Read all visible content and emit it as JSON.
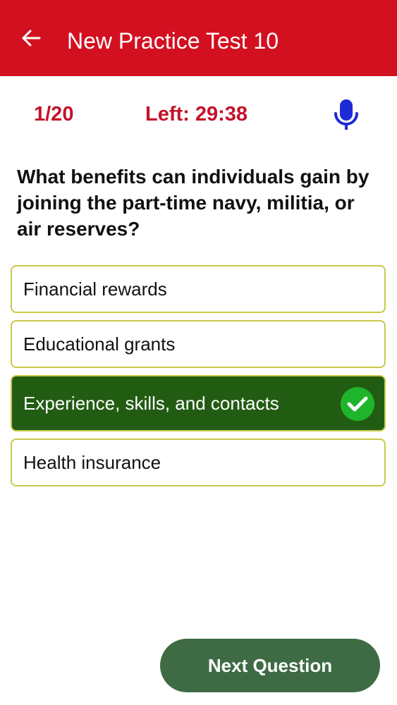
{
  "appbar": {
    "title": "New Practice Test 10",
    "back_icon": "arrow-left-icon",
    "background": "#d31020"
  },
  "status": {
    "counter": "1/20",
    "timer": "Left: 29:38",
    "mic_icon": "microphone-icon",
    "accent": "#c4132a",
    "mic_color": "#1d2bd6"
  },
  "question": {
    "text": "What benefits can individuals gain by joining the part-time navy, militia, or air reserves?"
  },
  "options": [
    {
      "label": "Financial rewards",
      "selected": false
    },
    {
      "label": "Educational grants",
      "selected": false
    },
    {
      "label": "Experience, skills, and contacts",
      "selected": true,
      "status_icon": "check-circle-icon"
    },
    {
      "label": "Health insurance",
      "selected": false
    }
  ],
  "footer": {
    "next_label": "Next Question"
  }
}
